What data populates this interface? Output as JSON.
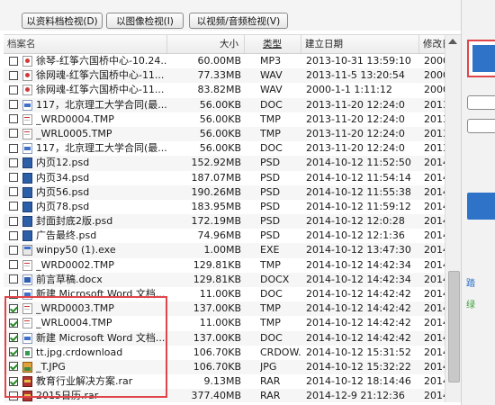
{
  "toolbar": {
    "doc_view": "以资料档检视(D)",
    "image_view": "以图像检视(I)",
    "media_view": "以视频/音频检视(V)"
  },
  "columns": {
    "name": "档案名",
    "size": "大小",
    "type": "类型",
    "created": "建立日期",
    "modified": "修改日"
  },
  "rows": [
    {
      "checked": false,
      "icon": "audio-file-icon",
      "name": "徐琴-红筝六国桥中心-10.24...",
      "size": "60.00MB",
      "type": "MP3",
      "created": "2013-10-31 13:59:10",
      "modified": "2000"
    },
    {
      "checked": false,
      "icon": "audio-file-icon",
      "name": "徐网魂-红筝六国桥中心-11...",
      "size": "77.33MB",
      "type": "WAV",
      "created": "2013-11-5 13:20:54",
      "modified": "2000"
    },
    {
      "checked": false,
      "icon": "audio-file-icon",
      "name": "徐网魂-红筝六国桥中心-11...",
      "size": "83.82MB",
      "type": "WAV",
      "created": "2000-1-1 1:11:12",
      "modified": "2000"
    },
    {
      "checked": false,
      "icon": "doc-file-icon",
      "name": "117，北京理工大学合同(最...",
      "size": "56.00KB",
      "type": "DOC",
      "created": "2013-11-20 12:24:0",
      "modified": "2013"
    },
    {
      "checked": false,
      "icon": "tmp-file-icon",
      "name": "_WRD0004.TMP",
      "size": "56.00KB",
      "type": "TMP",
      "created": "2013-11-20 12:24:0",
      "modified": "2013"
    },
    {
      "checked": false,
      "icon": "tmp-file-icon",
      "name": "_WRL0005.TMP",
      "size": "56.00KB",
      "type": "TMP",
      "created": "2013-11-20 12:24:0",
      "modified": "2013"
    },
    {
      "checked": false,
      "icon": "doc-file-icon",
      "name": "117，北京理工大学合同(最...",
      "size": "56.00KB",
      "type": "DOC",
      "created": "2013-11-20 12:24:0",
      "modified": "2013"
    },
    {
      "checked": false,
      "icon": "psd-file-icon",
      "name": "内页12.psd",
      "size": "152.92MB",
      "type": "PSD",
      "created": "2014-10-12 11:52:50",
      "modified": "2014"
    },
    {
      "checked": false,
      "icon": "psd-file-icon",
      "name": "内页34.psd",
      "size": "187.07MB",
      "type": "PSD",
      "created": "2014-10-12 11:54:14",
      "modified": "2014"
    },
    {
      "checked": false,
      "icon": "psd-file-icon",
      "name": "内页56.psd",
      "size": "190.26MB",
      "type": "PSD",
      "created": "2014-10-12 11:55:38",
      "modified": "2014"
    },
    {
      "checked": false,
      "icon": "psd-file-icon",
      "name": "内页78.psd",
      "size": "183.95MB",
      "type": "PSD",
      "created": "2014-10-12 11:59:12",
      "modified": "2014"
    },
    {
      "checked": false,
      "icon": "psd-file-icon",
      "name": "封面封底2版.psd",
      "size": "172.19MB",
      "type": "PSD",
      "created": "2014-10-12 12:0:28",
      "modified": "2014"
    },
    {
      "checked": false,
      "icon": "psd-file-icon",
      "name": "广告最终.psd",
      "size": "74.96MB",
      "type": "PSD",
      "created": "2014-10-12 12:1:36",
      "modified": "2014"
    },
    {
      "checked": false,
      "icon": "exe-file-icon",
      "name": "winpy50 (1).exe",
      "size": "1.00MB",
      "type": "EXE",
      "created": "2014-10-12 13:47:30",
      "modified": "2014"
    },
    {
      "checked": false,
      "icon": "tmp-file-icon",
      "name": "_WRD0002.TMP",
      "size": "129.81KB",
      "type": "TMP",
      "created": "2014-10-12 14:42:34",
      "modified": "2014"
    },
    {
      "checked": false,
      "icon": "docx-file-icon",
      "name": "前言草稿.docx",
      "size": "129.81KB",
      "type": "DOCX",
      "created": "2014-10-12 14:42:34",
      "modified": "2014"
    },
    {
      "checked": false,
      "icon": "doc-file-icon",
      "name": "新建 Microsoft Word 文档...",
      "size": "11.00KB",
      "type": "DOC",
      "created": "2014-10-12 14:42:42",
      "modified": "2014"
    },
    {
      "checked": true,
      "icon": "tmp-file-icon",
      "name": "_WRD0003.TMP",
      "size": "137.00KB",
      "type": "TMP",
      "created": "2014-10-12 14:42:42",
      "modified": "2014"
    },
    {
      "checked": true,
      "icon": "tmp-file-icon",
      "name": "_WRL0004.TMP",
      "size": "11.00KB",
      "type": "TMP",
      "created": "2014-10-12 14:42:42",
      "modified": "2014"
    },
    {
      "checked": true,
      "icon": "doc-file-icon",
      "name": "新建 Microsoft Word 文档...",
      "size": "137.00KB",
      "type": "DOC",
      "created": "2014-10-12 14:42:42",
      "modified": "2014"
    },
    {
      "checked": true,
      "icon": "crdownload-file-icon",
      "name": "tt.jpg.crdownload",
      "size": "106.70KB",
      "type": "CRDOW...",
      "created": "2014-10-12 15:31:52",
      "modified": "2014"
    },
    {
      "checked": true,
      "icon": "jpg-file-icon",
      "name": "_T.JPG",
      "size": "106.70KB",
      "type": "JPG",
      "created": "2014-10-12 15:32:22",
      "modified": "2014"
    },
    {
      "checked": true,
      "icon": "rar-file-icon",
      "name": "教育行业解决方案.rar",
      "size": "9.13MB",
      "type": "RAR",
      "created": "2014-10-12 18:14:46",
      "modified": "2014"
    },
    {
      "checked": false,
      "icon": "rar-file-icon",
      "name": "2015日历.rar",
      "size": "377.40MB",
      "type": "RAR",
      "created": "2014-12-9 21:12:36",
      "modified": "2014"
    }
  ],
  "side_panel": {
    "link_1": "踏",
    "link_2": "绿"
  }
}
